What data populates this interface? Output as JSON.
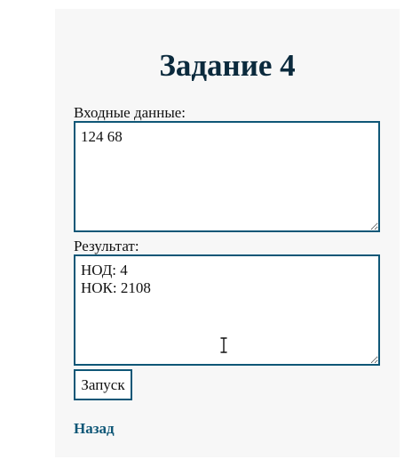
{
  "page": {
    "title": "Задание 4"
  },
  "form": {
    "input_label": "Входные данные:",
    "input_value": "124 68",
    "result_label": "Результат:",
    "result_value": "НОД: 4\nНОК: 2108",
    "run_label": "Запуск"
  },
  "nav": {
    "back_label": "Назад"
  },
  "colors": {
    "accent": "#0f5777",
    "title": "#0b2a3d",
    "panel_bg": "#f7f7f7"
  },
  "icons": {
    "cursor": "text-cursor-icon"
  }
}
